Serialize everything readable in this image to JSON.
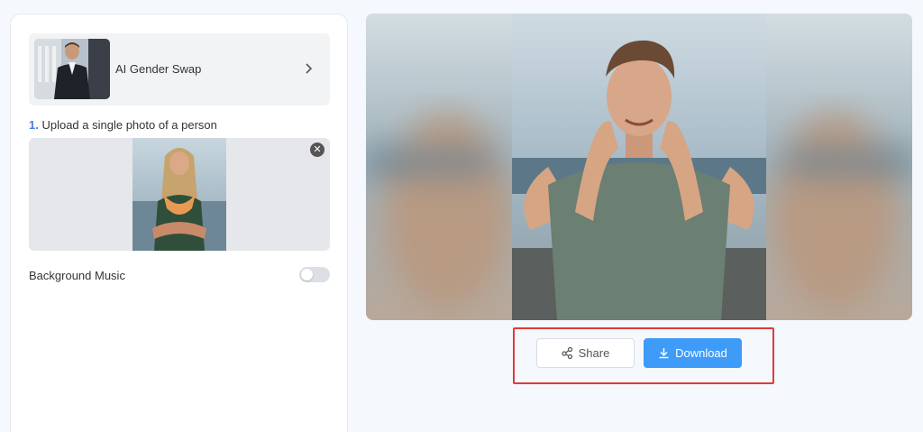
{
  "template": {
    "title": "AI Gender Swap",
    "chevron_icon": "chevron-right-icon"
  },
  "step": {
    "number": "1.",
    "label": "Upload a single photo of a person"
  },
  "upload": {
    "remove_icon": "close-icon"
  },
  "settings": {
    "background_music_label": "Background Music",
    "background_music_on": false
  },
  "actions": {
    "share_label": "Share",
    "share_icon": "share-icon",
    "download_label": "Download",
    "download_icon": "download-icon"
  },
  "colors": {
    "accent": "#3e9bf8",
    "step_number": "#4a7fe0",
    "highlight_border": "#e03a3a"
  }
}
